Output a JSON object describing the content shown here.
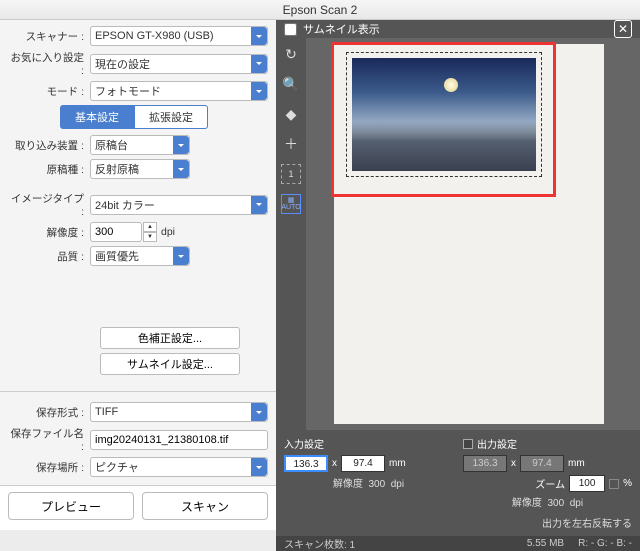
{
  "title": "Epson Scan 2",
  "left": {
    "scanner_label": "スキャナー :",
    "scanner_value": "EPSON GT-X980 (USB)",
    "fav_label": "お気に入り設定 :",
    "fav_value": "現在の設定",
    "mode_label": "モード :",
    "mode_value": "フォトモード",
    "tab_basic": "基本設定",
    "tab_adv": "拡張設定",
    "source_label": "取り込み装置 :",
    "source_value": "原稿台",
    "doctype_label": "原稿種 :",
    "doctype_value": "反射原稿",
    "imgtype_label": "イメージタイプ :",
    "imgtype_value": "24bit カラー",
    "res_label": "解像度 :",
    "res_value": "300",
    "res_unit": "dpi",
    "quality_label": "品質 :",
    "quality_value": "画質優先",
    "color_btn": "色補正設定...",
    "thumb_btn": "サムネイル設定...",
    "format_label": "保存形式 :",
    "format_value": "TIFF",
    "filename_label": "保存ファイル名 :",
    "filename_value": "img20240131_21380108.tif",
    "savefolder_label": "保存場所 :",
    "savefolder_value": "ピクチャ",
    "preview_btn": "プレビュー",
    "scan_btn": "スキャン"
  },
  "right": {
    "thumb_chk": "サムネイル表示",
    "input_hdr": "入力設定",
    "output_hdr": "出力設定",
    "w_in": "136.3",
    "h_in": "97.4",
    "w_out": "136.3",
    "h_out": "97.4",
    "x": "x",
    "mm": "mm",
    "res_lbl": "解像度",
    "res_in": "300",
    "res_out": "300",
    "dpi": "dpi",
    "zoom_lbl": "ズーム",
    "zoom_val": "100",
    "pct": "%",
    "flip": "出力を左右反転する",
    "scancount": "スキャン枚数: 1",
    "size": "5.55 MB",
    "rgb": "R: -    G: -    B: -"
  }
}
